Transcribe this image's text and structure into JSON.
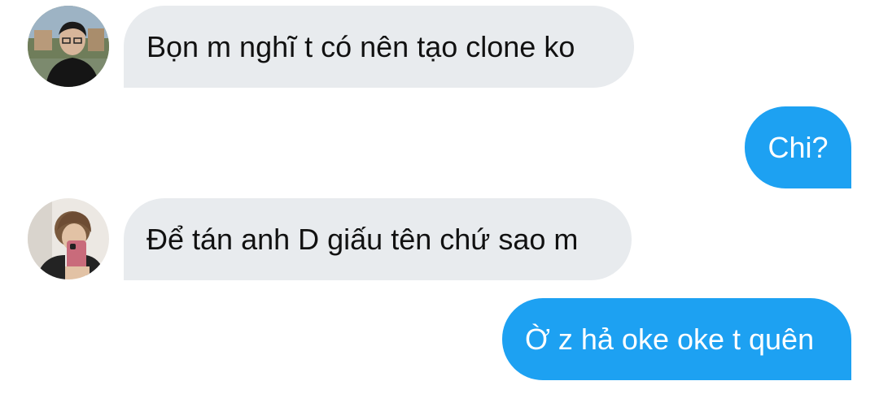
{
  "messages": [
    {
      "sender": "them",
      "text": "Bọn m nghĩ t có nên tạo clone ko"
    },
    {
      "sender": "me",
      "text": "Chi?"
    },
    {
      "sender": "them",
      "text": "Để tán anh D giấu tên chứ sao m"
    },
    {
      "sender": "me",
      "text": "Ờ z hả oke oke t quên"
    }
  ],
  "colors": {
    "incoming_bubble": "#e8ebee",
    "outgoing_bubble": "#1da1f2",
    "incoming_text": "#111111",
    "outgoing_text": "#ffffff"
  }
}
